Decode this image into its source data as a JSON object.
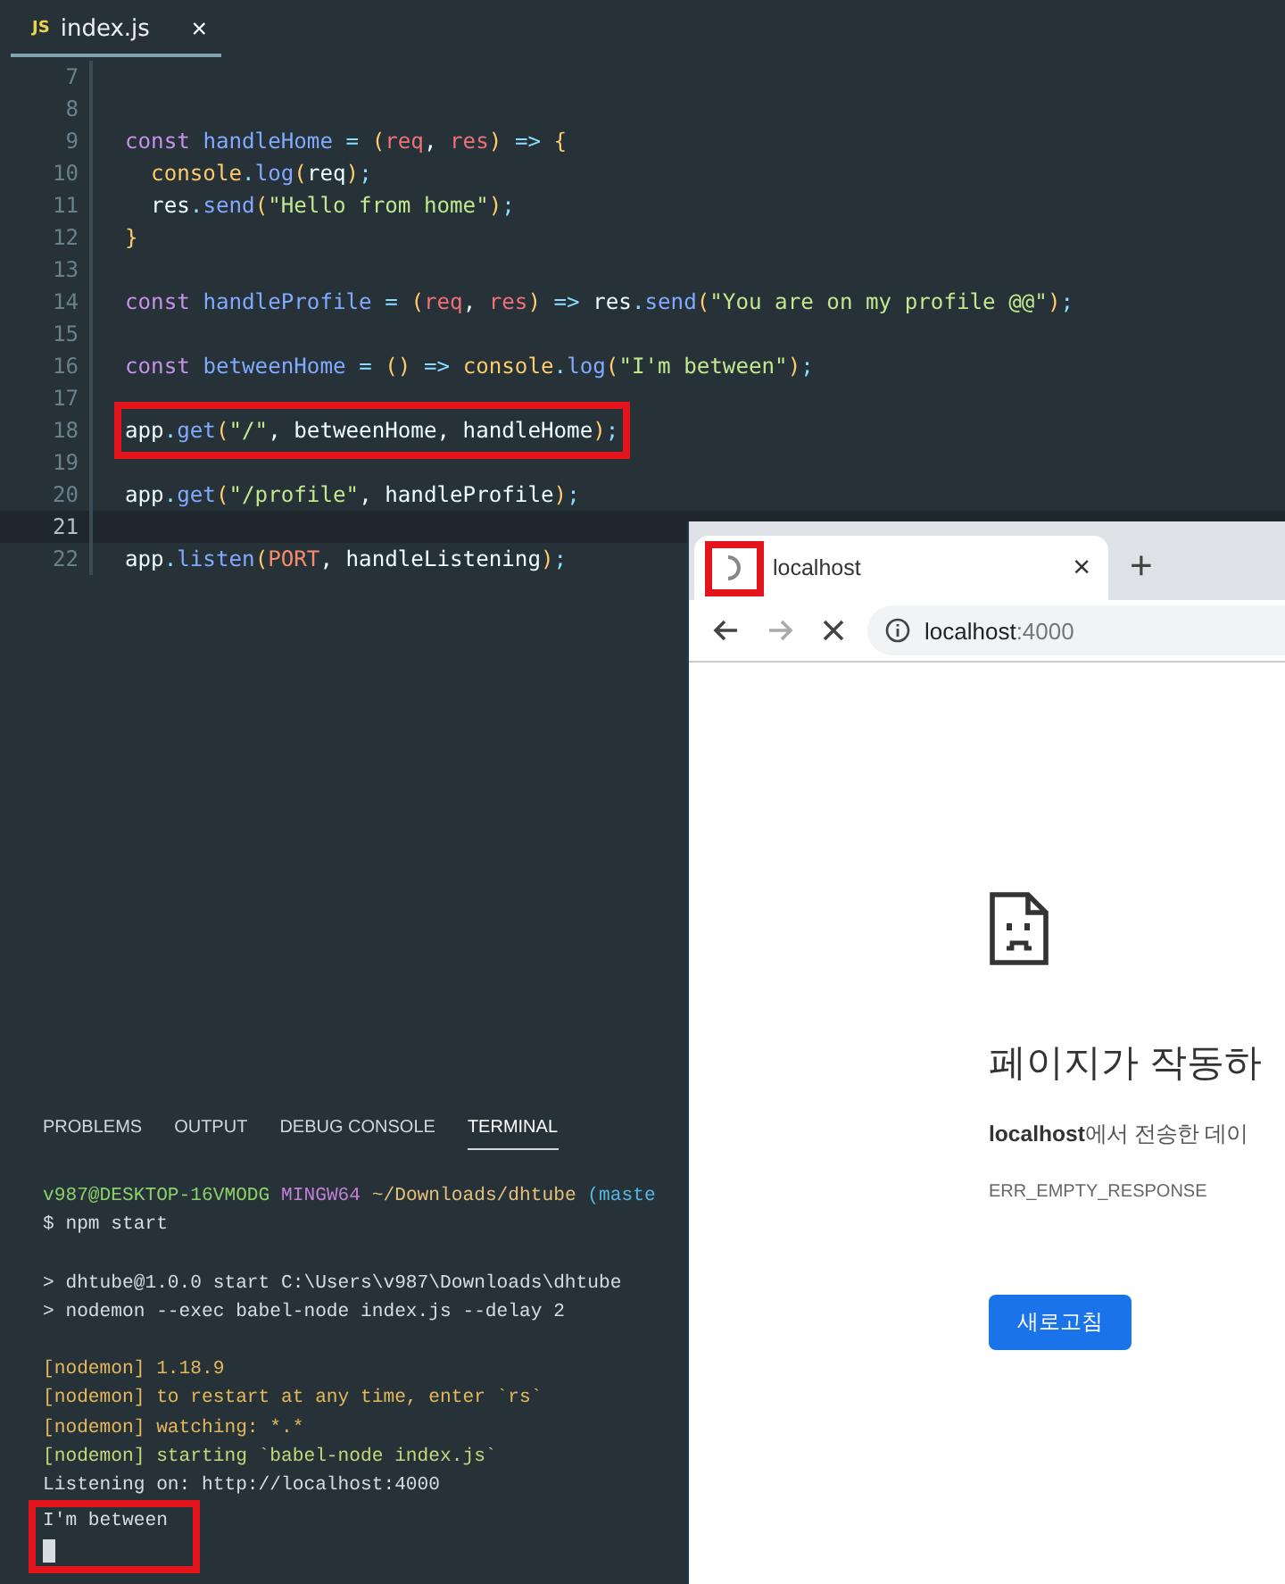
{
  "editor_tab": {
    "icon_text": "JS",
    "title": "index.js",
    "close": "×",
    "selected": true
  },
  "code_lines": [
    {
      "number": "7",
      "current": false,
      "highlighted": false
    },
    {
      "number": "8",
      "current": false,
      "highlighted": false
    },
    {
      "number": "9",
      "current": false,
      "highlighted": false,
      "tokens": [
        {
          "kind": "keyword",
          "text": "const "
        },
        {
          "kind": "function",
          "text": "handleHome "
        },
        {
          "kind": "punct",
          "text": "= "
        },
        {
          "kind": "bracket",
          "text": "("
        },
        {
          "kind": "param",
          "text": "req"
        },
        {
          "kind": "plain",
          "text": ", "
        },
        {
          "kind": "param",
          "text": "res"
        },
        {
          "kind": "bracket",
          "text": ") "
        },
        {
          "kind": "punct",
          "text": "=> "
        },
        {
          "kind": "bracket",
          "text": "{"
        }
      ]
    },
    {
      "number": "10",
      "current": false,
      "highlighted": false,
      "tokens": [
        {
          "kind": "object",
          "text": "  console"
        },
        {
          "kind": "punct",
          "text": "."
        },
        {
          "kind": "function",
          "text": "log"
        },
        {
          "kind": "bracket",
          "text": "("
        },
        {
          "kind": "plain",
          "text": "req"
        },
        {
          "kind": "bracket",
          "text": ")"
        },
        {
          "kind": "punct",
          "text": ";"
        }
      ]
    },
    {
      "number": "11",
      "current": false,
      "highlighted": false,
      "tokens": [
        {
          "kind": "plain",
          "text": "  res"
        },
        {
          "kind": "punct",
          "text": "."
        },
        {
          "kind": "function",
          "text": "send"
        },
        {
          "kind": "bracket",
          "text": "("
        },
        {
          "kind": "string",
          "text": "\"Hello from home\""
        },
        {
          "kind": "bracket",
          "text": ")"
        },
        {
          "kind": "punct",
          "text": ";"
        }
      ]
    },
    {
      "number": "12",
      "current": false,
      "highlighted": false,
      "tokens": [
        {
          "kind": "bracket",
          "text": "}"
        }
      ]
    },
    {
      "number": "13",
      "current": false,
      "highlighted": false
    },
    {
      "number": "14",
      "current": false,
      "highlighted": false,
      "tokens": [
        {
          "kind": "keyword",
          "text": "const "
        },
        {
          "kind": "function",
          "text": "handleProfile "
        },
        {
          "kind": "punct",
          "text": "= "
        },
        {
          "kind": "bracket",
          "text": "("
        },
        {
          "kind": "param",
          "text": "req"
        },
        {
          "kind": "plain",
          "text": ", "
        },
        {
          "kind": "param",
          "text": "res"
        },
        {
          "kind": "bracket",
          "text": ") "
        },
        {
          "kind": "punct",
          "text": "=> "
        },
        {
          "kind": "plain",
          "text": "res"
        },
        {
          "kind": "punct",
          "text": "."
        },
        {
          "kind": "function",
          "text": "send"
        },
        {
          "kind": "bracket",
          "text": "("
        },
        {
          "kind": "string",
          "text": "\"You are on my profile @@\""
        },
        {
          "kind": "bracket",
          "text": ")"
        },
        {
          "kind": "punct",
          "text": ";"
        }
      ]
    },
    {
      "number": "15",
      "current": false,
      "highlighted": false
    },
    {
      "number": "16",
      "current": false,
      "highlighted": false,
      "tokens": [
        {
          "kind": "keyword",
          "text": "const "
        },
        {
          "kind": "function",
          "text": "betweenHome "
        },
        {
          "kind": "punct",
          "text": "= "
        },
        {
          "kind": "bracket",
          "text": "() "
        },
        {
          "kind": "punct",
          "text": "=> "
        },
        {
          "kind": "object",
          "text": "console"
        },
        {
          "kind": "punct",
          "text": "."
        },
        {
          "kind": "function",
          "text": "log"
        },
        {
          "kind": "bracket",
          "text": "("
        },
        {
          "kind": "string",
          "text": "\"I'm between\""
        },
        {
          "kind": "bracket",
          "text": ")"
        },
        {
          "kind": "punct",
          "text": ";"
        }
      ]
    },
    {
      "number": "17",
      "current": false,
      "highlighted": false
    },
    {
      "number": "18",
      "current": false,
      "highlighted": true,
      "tokens": [
        {
          "kind": "plain",
          "text": "app"
        },
        {
          "kind": "punct",
          "text": "."
        },
        {
          "kind": "function",
          "text": "get"
        },
        {
          "kind": "bracket",
          "text": "("
        },
        {
          "kind": "string",
          "text": "\"/\""
        },
        {
          "kind": "plain",
          "text": ", betweenHome, handleHome"
        },
        {
          "kind": "bracket",
          "text": ")"
        },
        {
          "kind": "punct",
          "text": ";"
        }
      ]
    },
    {
      "number": "19",
      "current": false,
      "highlighted": false
    },
    {
      "number": "20",
      "current": false,
      "highlighted": false,
      "tokens": [
        {
          "kind": "plain",
          "text": "app"
        },
        {
          "kind": "punct",
          "text": "."
        },
        {
          "kind": "function",
          "text": "get"
        },
        {
          "kind": "bracket",
          "text": "("
        },
        {
          "kind": "string",
          "text": "\"/profile\""
        },
        {
          "kind": "plain",
          "text": ", handleProfile"
        },
        {
          "kind": "bracket",
          "text": ")"
        },
        {
          "kind": "punct",
          "text": ";"
        }
      ]
    },
    {
      "number": "21",
      "current": true,
      "highlighted": false
    },
    {
      "number": "22",
      "current": false,
      "highlighted": false,
      "tokens": [
        {
          "kind": "plain",
          "text": "app"
        },
        {
          "kind": "punct",
          "text": "."
        },
        {
          "kind": "function",
          "text": "listen"
        },
        {
          "kind": "bracket",
          "text": "("
        },
        {
          "kind": "constant",
          "text": "PORT"
        },
        {
          "kind": "plain",
          "text": ", handleListening"
        },
        {
          "kind": "bracket",
          "text": ")"
        },
        {
          "kind": "punct",
          "text": ";"
        }
      ]
    }
  ],
  "panel_tabs": [
    {
      "label": "PROBLEMS",
      "selected": false
    },
    {
      "label": "OUTPUT",
      "selected": false
    },
    {
      "label": "DEBUG CONSOLE",
      "selected": false
    },
    {
      "label": "TERMINAL",
      "selected": true
    }
  ],
  "terminal_lines": [
    {
      "highlighted": false,
      "segments": [
        {
          "kind": "user",
          "text": "v987@DESKTOP-16VMODG "
        },
        {
          "kind": "system",
          "text": "MINGW64 "
        },
        {
          "kind": "path",
          "text": "~/Downloads/dhtube "
        },
        {
          "kind": "branch",
          "text": "(maste"
        }
      ]
    },
    {
      "highlighted": false,
      "segments": [
        {
          "kind": "plain",
          "text": "$ npm start"
        }
      ]
    },
    {
      "highlighted": false,
      "spaced": true,
      "segments": [
        {
          "kind": "plain",
          "text": "> dhtube@1.0.0 start C:\\Users\\v987\\Downloads\\dhtube"
        }
      ]
    },
    {
      "highlighted": false,
      "segments": [
        {
          "kind": "plain",
          "text": "> nodemon --exec babel-node index.js --delay 2"
        }
      ]
    },
    {
      "highlighted": false,
      "spaced": true,
      "segments": [
        {
          "kind": "info",
          "text": "[nodemon] 1.18.9"
        }
      ]
    },
    {
      "highlighted": false,
      "segments": [
        {
          "kind": "info",
          "text": "[nodemon] to restart at any time, enter `rs`"
        }
      ]
    },
    {
      "highlighted": false,
      "segments": [
        {
          "kind": "info",
          "text": "[nodemon] watching: *.*"
        }
      ]
    },
    {
      "highlighted": false,
      "segments": [
        {
          "kind": "success",
          "text": "[nodemon] starting `babel-node index.js`"
        }
      ]
    },
    {
      "highlighted": false,
      "segments": [
        {
          "kind": "plain",
          "text": "Listening on: http://localhost:4000"
        }
      ]
    },
    {
      "highlighted": true,
      "segments": [
        {
          "kind": "plain",
          "text": "I'm between"
        }
      ]
    }
  ],
  "browser": {
    "tab_title": "localhost",
    "tab_loading": true,
    "tab_close": "×",
    "new_tab": "+",
    "address_host": "localhost",
    "address_port": ":4000",
    "error": {
      "heading": "페이지가 작동하",
      "message": "**localhost**에서 전송한 데이",
      "code": "ERR_EMPTY_RESPONSE",
      "reload_button": "새로고침"
    }
  }
}
